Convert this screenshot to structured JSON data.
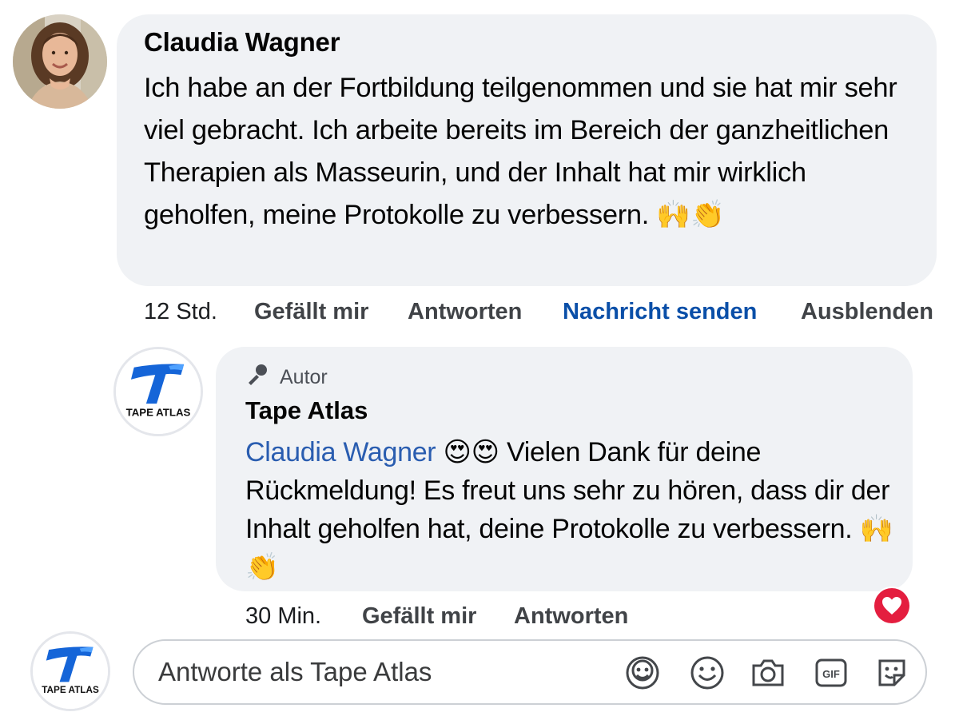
{
  "comment": {
    "author": "Claudia Wagner",
    "text": "Ich habe an der Fortbildung teilgenommen und sie hat mir sehr viel gebracht. Ich arbeite bereits im Bereich der ganzheitlichen Therapien als Masseurin, und der Inhalt hat mir wirklich geholfen, meine Protokolle zu verbessern.",
    "emoji": "🙌👏",
    "time": "12 Std.",
    "like_label": "Gefällt mir",
    "reply_label": "Antworten",
    "message_label": "Nachricht senden",
    "hide_label": "Ausblenden"
  },
  "reply": {
    "badge": "Autor",
    "author": "Tape Atlas",
    "mention": "Claudia Wagner",
    "mention_emoji": "😍😍",
    "text": "Vielen Dank für deine Rückmeldung! Es freut uns sehr zu hören, dass dir der Inhalt geholfen hat, deine Protokolle zu verbessern.",
    "emoji": "🙌👏",
    "time": "30 Min.",
    "like_label": "Gefällt mir",
    "reply_label": "Antworten",
    "reaction": "heart-reaction-icon"
  },
  "brand": {
    "logo_text": "TAPE ATLAS",
    "logo_color": "#1565d8"
  },
  "composer": {
    "placeholder": "Antworte als Tape Atlas",
    "icons": [
      "avatar-sticker-icon",
      "emoji-icon",
      "camera-icon",
      "gif-icon",
      "sticker-icon"
    ],
    "gif_text": "GIF"
  },
  "colors": {
    "bubble": "#f0f2f5",
    "link": "#0a4fa8",
    "mention": "#2a5db0",
    "heart": "#e41e3f"
  }
}
